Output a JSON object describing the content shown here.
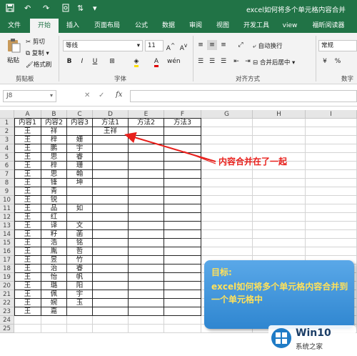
{
  "window": {
    "title": "excel如何将多个单元格内容合并"
  },
  "quick_access": {
    "save_icon": "save-icon",
    "undo_icon": "undo-icon",
    "redo_icon": "redo-icon"
  },
  "tabs": [
    {
      "label": "文件"
    },
    {
      "label": "开始"
    },
    {
      "label": "插入"
    },
    {
      "label": "页面布局"
    },
    {
      "label": "公式"
    },
    {
      "label": "数据"
    },
    {
      "label": "审阅"
    },
    {
      "label": "视图"
    },
    {
      "label": "开发工具"
    },
    {
      "label": "view"
    },
    {
      "label": "福昕阅读器"
    }
  ],
  "ribbon": {
    "paste": "粘贴",
    "cut": "剪切",
    "copy": "复制",
    "format_painter": "格式刷",
    "clipboard_group": "剪贴板",
    "font_name": "等线",
    "font_size": "11",
    "bold": "B",
    "italic": "I",
    "underline": "U",
    "font_color_letter": "A",
    "font_group": "字体",
    "wrap_text": "自动换行",
    "merge_center": "合并后居中",
    "align_group": "对齐方式",
    "number_format": "常规",
    "number_group": "数字"
  },
  "formula_bar": {
    "name_box": "J8",
    "fx": "fx"
  },
  "sheet": {
    "columns": [
      "A",
      "B",
      "C",
      "D",
      "E",
      "F",
      "G",
      "H",
      "I"
    ],
    "rows": [
      [
        "内容1",
        "内容2",
        "内容3",
        "方法1",
        "方法2",
        "方法3"
      ],
      [
        "王",
        "祥",
        "",
        "王祥",
        "",
        ""
      ],
      [
        "王",
        "梓",
        "姗",
        "",
        "",
        ""
      ],
      [
        "王",
        "鹏",
        "宇",
        "",
        "",
        ""
      ],
      [
        "王",
        "思",
        "睿",
        "",
        "",
        ""
      ],
      [
        "王",
        "梓",
        "珊",
        "",
        "",
        ""
      ],
      [
        "王",
        "思",
        "翰",
        "",
        "",
        ""
      ],
      [
        "王",
        "锋",
        "坤",
        "",
        "",
        ""
      ],
      [
        "王",
        "青",
        "",
        "",
        "",
        ""
      ],
      [
        "王",
        "锐",
        "",
        "",
        "",
        ""
      ],
      [
        "王",
        "品",
        "如",
        "",
        "",
        ""
      ],
      [
        "王",
        "红",
        "",
        "",
        "",
        ""
      ],
      [
        "王",
        "译",
        "文",
        "",
        "",
        ""
      ],
      [
        "王",
        "籽",
        "菡",
        "",
        "",
        ""
      ],
      [
        "王",
        "浩",
        "铭",
        "",
        "",
        ""
      ],
      [
        "王",
        "胤",
        "哲",
        "",
        "",
        ""
      ],
      [
        "王",
        "昱",
        "竹",
        "",
        "",
        ""
      ],
      [
        "王",
        "治",
        "睿",
        "",
        "",
        ""
      ],
      [
        "王",
        "怡",
        "帆",
        "",
        "",
        ""
      ],
      [
        "王",
        "璐",
        "阳",
        "",
        "",
        ""
      ],
      [
        "王",
        "佩",
        "宇",
        "",
        "",
        ""
      ],
      [
        "王",
        "婉",
        "玉",
        "",
        "",
        ""
      ],
      [
        "王",
        "嘉",
        "",
        "",
        "",
        ""
      ]
    ]
  },
  "annotation": "内容合并在了一起",
  "goal": {
    "title": "目标:",
    "text": "excel如何将多个单元格内容合并到一个单元格中"
  },
  "watermark": {
    "brand": "Win10",
    "site": "系统之家"
  },
  "colors": {
    "excel_green": "#217346",
    "arrow_red": "#e8201c",
    "goal_blue": "#2f86d0",
    "goal_text": "#ffe15a"
  }
}
